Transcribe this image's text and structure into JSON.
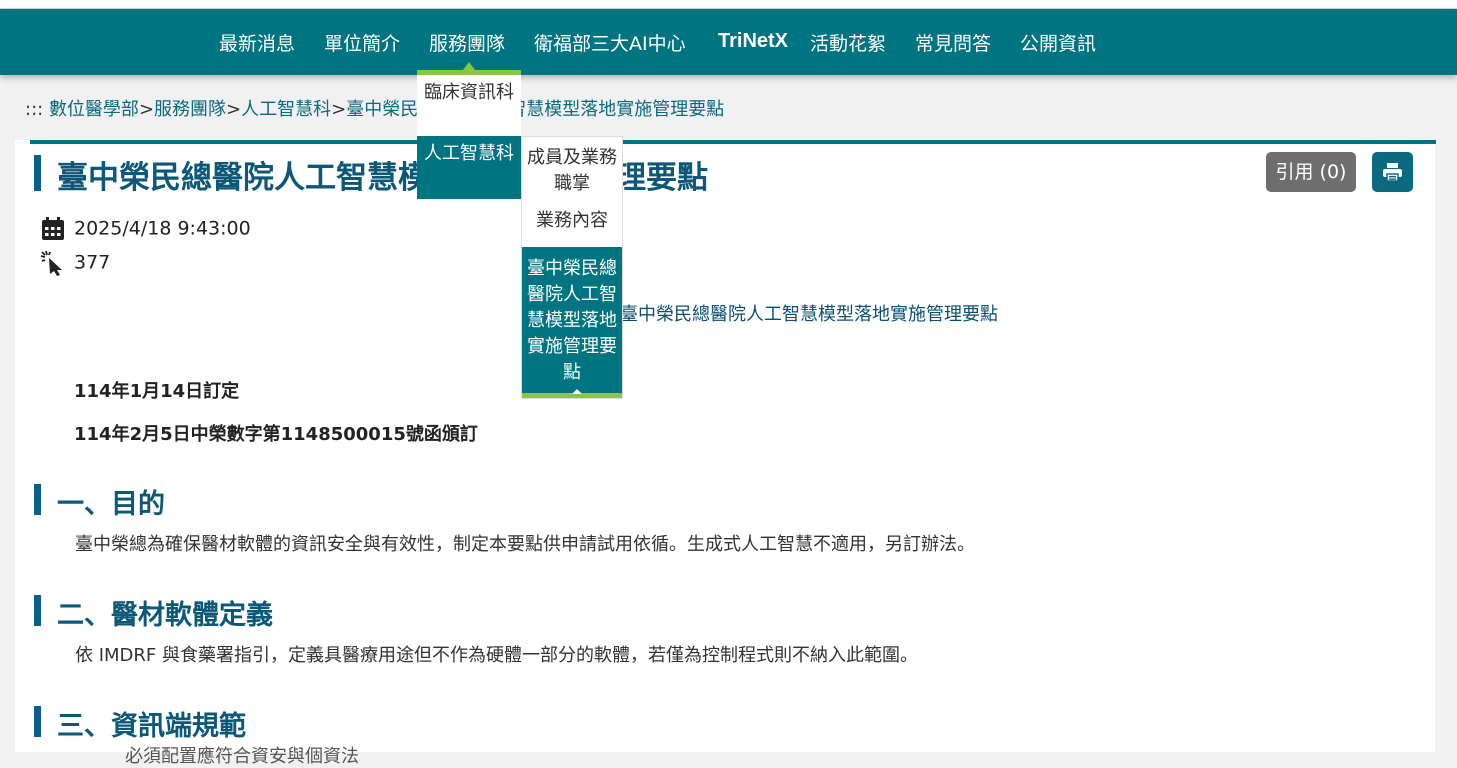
{
  "nav": {
    "items": [
      "最新消息",
      "單位簡介",
      "服務團隊",
      "衛福部三大AI中心",
      "TriNetX",
      "活動花絮",
      "常見問答",
      "公開資訊"
    ]
  },
  "breadcrumb": {
    "prefix": ":::",
    "items": [
      "數位醫學部",
      "服務團隊",
      "人工智慧科",
      "臺中榮民總醫院人工智慧模型落地實施管理要點"
    ],
    "separator": ">"
  },
  "dropdown": {
    "level1": [
      "臨床資訊科",
      "人工智慧科"
    ],
    "level2": [
      "成員及業務職掌",
      "業務內容",
      "臺中榮民總醫院人工智慧模型落地實施管理要點"
    ]
  },
  "article": {
    "title": "臺中榮民總醫院人工智慧模型落地實施管理要點",
    "cite_label": "引用 (0)",
    "date": "2025/4/18 9:43:00",
    "views": "377",
    "link_text": "臺中榮民總醫院人工智慧模型落地實施管理要點",
    "enacted": "114年1月14日訂定",
    "promulgated": "114年2月5日中榮數字第1148500015號函頒訂",
    "sections": [
      {
        "title": "一、目的",
        "body": "臺中榮總為確保醫材軟體的資訊安全與有效性，制定本要點供申請試用依循。生成式人工智慧不適用，另訂辦法。"
      },
      {
        "title": "二、醫材軟體定義",
        "body": "依 IMDRF 與食藥署指引，定義具醫療用途但不作為硬體一部分的軟體，若僅為控制程式則不納入此範圍。"
      },
      {
        "title": "三、資訊端規範",
        "body": "必須配置應符合資安與個資法"
      }
    ]
  },
  "colors": {
    "nav_bg": "#007480",
    "accent_green": "#8cc63f",
    "title_blue": "#0d5878"
  }
}
